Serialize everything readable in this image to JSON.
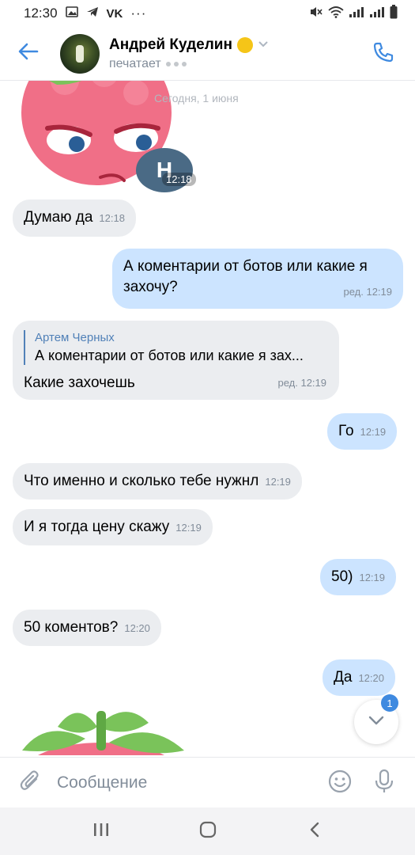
{
  "status_bar": {
    "time": "12:30",
    "app_badge": "VK",
    "more": "···"
  },
  "header": {
    "name": "Андрей Куделин",
    "status": "печатает"
  },
  "chat": {
    "date": "Сегодня, 1 июня",
    "sticker_time": "12:18",
    "messages": [
      {
        "text": "Думаю да",
        "time": "12:18"
      },
      {
        "text_line1": "А коментарии от ботов или какие я",
        "text_line2": "захочу?",
        "time": "ред. 12:19"
      },
      {
        "reply_author": "Артем Черных",
        "reply_text": "А коментарии от ботов или какие я зах...",
        "text": "Какие захочешь",
        "time": "ред. 12:19"
      },
      {
        "text": "Го",
        "time": "12:19"
      },
      {
        "text": "Что именно и сколько тебе нужнл",
        "time": "12:19"
      },
      {
        "text": "И я тогда цену скажу",
        "time": "12:19"
      },
      {
        "text": "50)",
        "time": "12:19"
      },
      {
        "text": "50 коментов?",
        "time": "12:20"
      },
      {
        "text": "Да",
        "time": "12:20"
      }
    ],
    "unread_count": "1"
  },
  "composer": {
    "placeholder": "Сообщение"
  },
  "colors": {
    "incoming_bubble": "#ebedf0",
    "outgoing_bubble": "#cce4ff",
    "accent": "#3f8ae0",
    "meta_text": "#818c99"
  },
  "icons": {
    "back": "arrow-left-icon",
    "call": "phone-icon",
    "attach": "paperclip-icon",
    "emoji": "smile-icon",
    "mic": "microphone-icon",
    "scroll_down": "chevron-down-icon",
    "nav_recent": "recent-apps-icon",
    "nav_home": "home-icon",
    "nav_back": "nav-back-icon"
  }
}
